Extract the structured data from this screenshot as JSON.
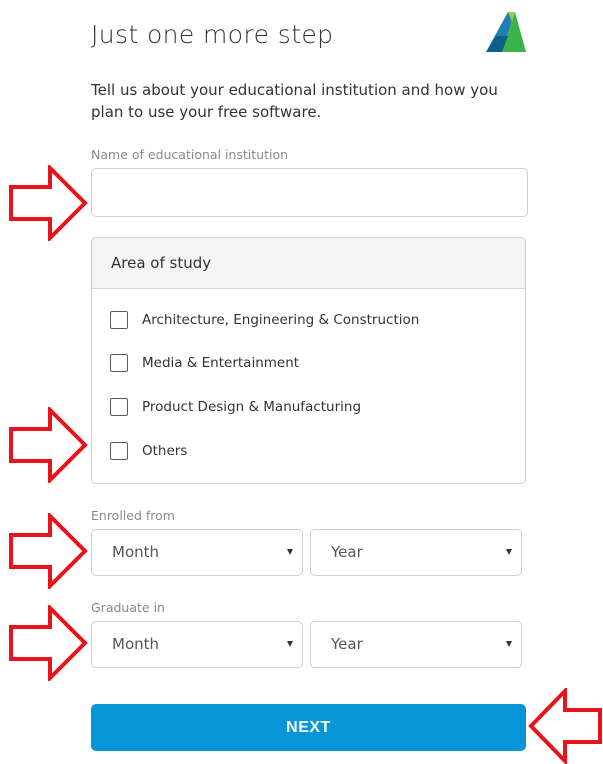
{
  "header": {
    "title": "Just one more step",
    "logo_icon": "autodesk-logo-icon"
  },
  "intro": "Tell us about your educational institution and how you plan to use your free software.",
  "institution": {
    "label": "Name of educational institution",
    "value": "",
    "placeholder": ""
  },
  "study": {
    "header": "Area of study",
    "options": [
      {
        "label": "Architecture, Engineering & Construction",
        "checked": false
      },
      {
        "label": "Media & Entertainment",
        "checked": false
      },
      {
        "label": "Product Design & Manufacturing",
        "checked": false
      },
      {
        "label": "Others",
        "checked": false
      }
    ]
  },
  "enrolled": {
    "label": "Enrolled from",
    "month": "Month",
    "year": "Year"
  },
  "graduate": {
    "label": "Graduate in",
    "month": "Month",
    "year": "Year"
  },
  "next_label": "NEXT",
  "colors": {
    "accent": "#0696d7",
    "annotation_arrow": "#e8141b"
  },
  "annotations": {
    "arrow_icon": "red-outline-arrow-icon",
    "count": 5
  }
}
